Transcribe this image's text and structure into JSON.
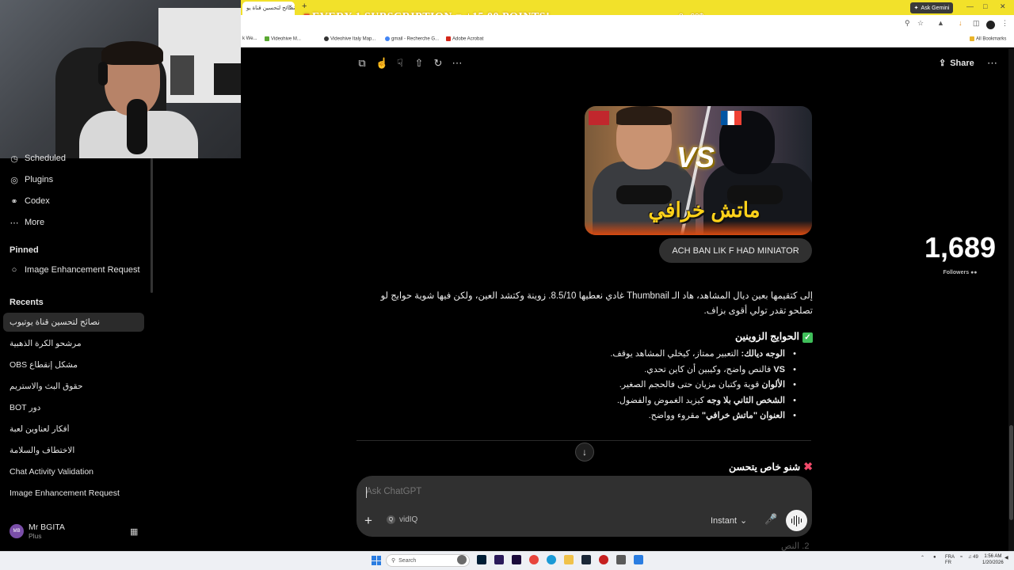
{
  "browser": {
    "active_tab_title": "نصائح لتحسين قناة يو",
    "tab_close": "×",
    "new_tab": "+",
    "ask_gemini": "Ask Gemini",
    "bookmarks": [
      "k We...",
      "Videohive M...",
      "Videohive Italy Map...",
      "gmail - Recherche G...",
      "Adobe Acrobat"
    ],
    "all_bookmarks": "All Bookmarks"
  },
  "stream_overlay": {
    "banner": "EVERY 1 SUBSCRIPTION = +15.00 POINTS!",
    "count": "8 - 20$"
  },
  "sidebar": {
    "nav": [
      {
        "label": "Scheduled",
        "icon": "clock-icon"
      },
      {
        "label": "Plugins",
        "icon": "plugin-icon"
      },
      {
        "label": "Codex",
        "icon": "codex-icon"
      },
      {
        "label": "More",
        "icon": "more-dots-icon"
      }
    ],
    "pinned_title": "Pinned",
    "pinned": [
      {
        "label": "Image Enhancement Request"
      }
    ],
    "recents_title": "Recents",
    "recents": [
      "نصائح لتحسين قناة يوتيوب",
      "مرشحو الكرة الذهبية",
      "مشكل إنقطاع OBS",
      "حقوق البث والاستريم",
      "دور BOT",
      "أفكار لعناوين لعبة",
      "الاختطاف والسلامة",
      "Chat Activity Validation",
      "Image Enhancement Request"
    ],
    "user": {
      "name": "Mr BGITA",
      "plan": "Plus",
      "initials": "MB"
    }
  },
  "toolbar": {
    "share_label": "Share"
  },
  "conversation": {
    "thumbnail": {
      "vs_text": "VS",
      "title_text": "ماتش خرافي"
    },
    "user_message": "ACH BAN LIK F HAD MINIATOR",
    "answer_intro": "إلى كتقيمها بعين ديال المشاهد، هاد الـ Thumbnail غادي نعطيها 8.5/10. زوينة وكتشد العين، ولكن فيها شوية حوايج لو تصلحو تقدر تولي أقوى بزاف.",
    "good_heading": "الحوايج الزوينين",
    "good_points": [
      {
        "bold": "الوجه ديالك:",
        "text": " التعبير ممتاز، كيخلي المشاهد يوقف."
      },
      {
        "bold": "VS",
        "text": " فالنص واضح، وكيبين أن كاين تحدي."
      },
      {
        "bold": "الألوان",
        "text": " قوية وكتبان مزيان حتى فالحجم الصغير."
      },
      {
        "bold": "الشخص الثاني بلا وجه",
        "text": " كيزيد الغموض والفضول."
      },
      {
        "bold": "العنوان \"ماتش خرافي\"",
        "text": " مقروء وواضح."
      }
    ],
    "improve_heading": "شنو خاص يتحسن",
    "peek_text": "2. النص"
  },
  "followers": {
    "count": "1,689",
    "label": "Followers"
  },
  "composer": {
    "placeholder": "Ask ChatGPT",
    "plugin_label": "vidIQ",
    "mode_label": "Instant"
  },
  "taskbar": {
    "search_label": "Search",
    "lang": "FRA",
    "lang_sub": "FR",
    "volume": "49",
    "time": "1:56 AM",
    "date": "1/20/2026"
  }
}
